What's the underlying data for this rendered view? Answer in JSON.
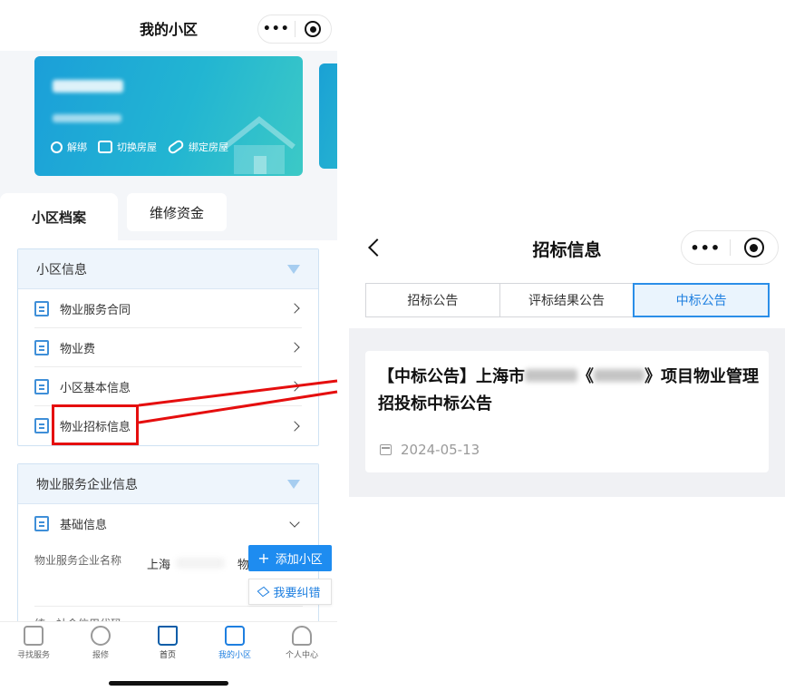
{
  "left_app": {
    "title": "我的小区",
    "capsule": {
      "more_glyph": "•••"
    },
    "house_card": {
      "actions": [
        {
          "label": "解绑",
          "icon": "unbind-icon"
        },
        {
          "label": "切换房屋",
          "icon": "switch-house-icon"
        },
        {
          "label": "绑定房屋",
          "icon": "link-icon"
        }
      ]
    },
    "tabs": [
      "小区档案",
      "维修资金"
    ],
    "community_info": {
      "title": "小区信息",
      "items": [
        {
          "label": "物业服务合同",
          "icon": "contract-icon"
        },
        {
          "label": "物业费",
          "icon": "yuan-fee-icon"
        },
        {
          "label": "小区基本信息",
          "icon": "community-icon"
        },
        {
          "label": "物业招标信息",
          "icon": "bidding-icon"
        }
      ]
    },
    "property_company": {
      "title": "物业服务企业信息",
      "basic_label": "基础信息",
      "company_name_label": "物业服务企业名称",
      "company_name_value": "上海",
      "company_name_tail": "物",
      "credit_code_label": "统一社会信用代码"
    },
    "floating": {
      "add_community": "添加小区",
      "report_error": "我要纠错",
      "plus_glyph": "+"
    },
    "tabbar": [
      {
        "label": "寻找服务",
        "icon": "search-doc-icon"
      },
      {
        "label": "报修",
        "icon": "tools-icon"
      },
      {
        "label": "首页",
        "icon": "home-icon"
      },
      {
        "label": "我的小区",
        "icon": "building-icon"
      },
      {
        "label": "个人中心",
        "icon": "user-icon"
      }
    ],
    "colors": {
      "accent": "#1e8cf0",
      "highlight": "#e50e0e",
      "card_start": "#1b9fd9",
      "card_end": "#3cc9c6"
    }
  },
  "right_app": {
    "title": "招标信息",
    "capsule": {
      "more_glyph": "•••"
    },
    "segments": [
      {
        "label": "招标公告",
        "active": false
      },
      {
        "label": "评标结果公告",
        "active": false
      },
      {
        "label": "中标公告",
        "active": true
      }
    ],
    "notice": {
      "title_prefix": "【中标公告】上海市",
      "title_mid": "《",
      "title_suffix": "》项目物业管理招投标中标公告",
      "date": "2024-05-13"
    }
  }
}
